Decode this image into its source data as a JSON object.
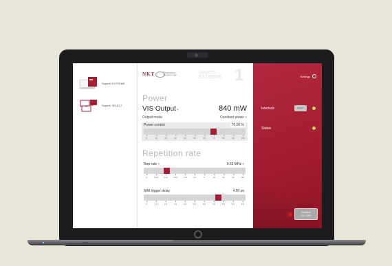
{
  "sidebar": {
    "devices": [
      {
        "name": "SuperK EXTREME"
      },
      {
        "name": "SuperK SELECT"
      }
    ]
  },
  "header": {
    "logo": "NKT",
    "logo_line1": "Photonics",
    "logo_line2": "The power of light",
    "watermark": "SuperK EXTREME",
    "watermark_num": "1"
  },
  "power": {
    "title": "Power",
    "output_label": "VIS Output",
    "output_value": "840 mW",
    "mode_label": "Output mode",
    "mode_value": "Constant power",
    "control_label": "Power control",
    "control_value": "70.00 %",
    "control_level": 0.7,
    "ticks": [
      "0",
      "10",
      "20",
      "30",
      "40",
      "50",
      "60",
      "70",
      "80",
      "90",
      "100"
    ]
  },
  "reprate": {
    "title": "Repetition rate",
    "rate_label": "Rep rate",
    "rate_value": "0.63 MHz",
    "rate_level": 0.21,
    "rate_ticks": [
      "0",
      "0.16",
      "0.31",
      "0.63",
      "1.25",
      "2.5",
      "5",
      "10",
      "20",
      "40",
      "80"
    ],
    "nim_label": "NIM trigger delay",
    "nim_value": "4.50 ps",
    "nim_level": 0.75,
    "nim_ticks": [
      "0",
      "1.5",
      "2.5",
      "3.5",
      "4.5",
      "5.5",
      "6.0",
      "4.5",
      "5.5",
      "5.5",
      "6.0"
    ]
  },
  "right": {
    "settings_label": "Settings",
    "interlock_label": "Interlock",
    "reset_label": "RESET",
    "status_label": "Status",
    "emission_line1": "Emission",
    "emission_line2": "ON / OFF"
  },
  "colors": {
    "accent": "#a51f32",
    "led_ok": "#c6d84a",
    "led_emission": "#e02020"
  }
}
